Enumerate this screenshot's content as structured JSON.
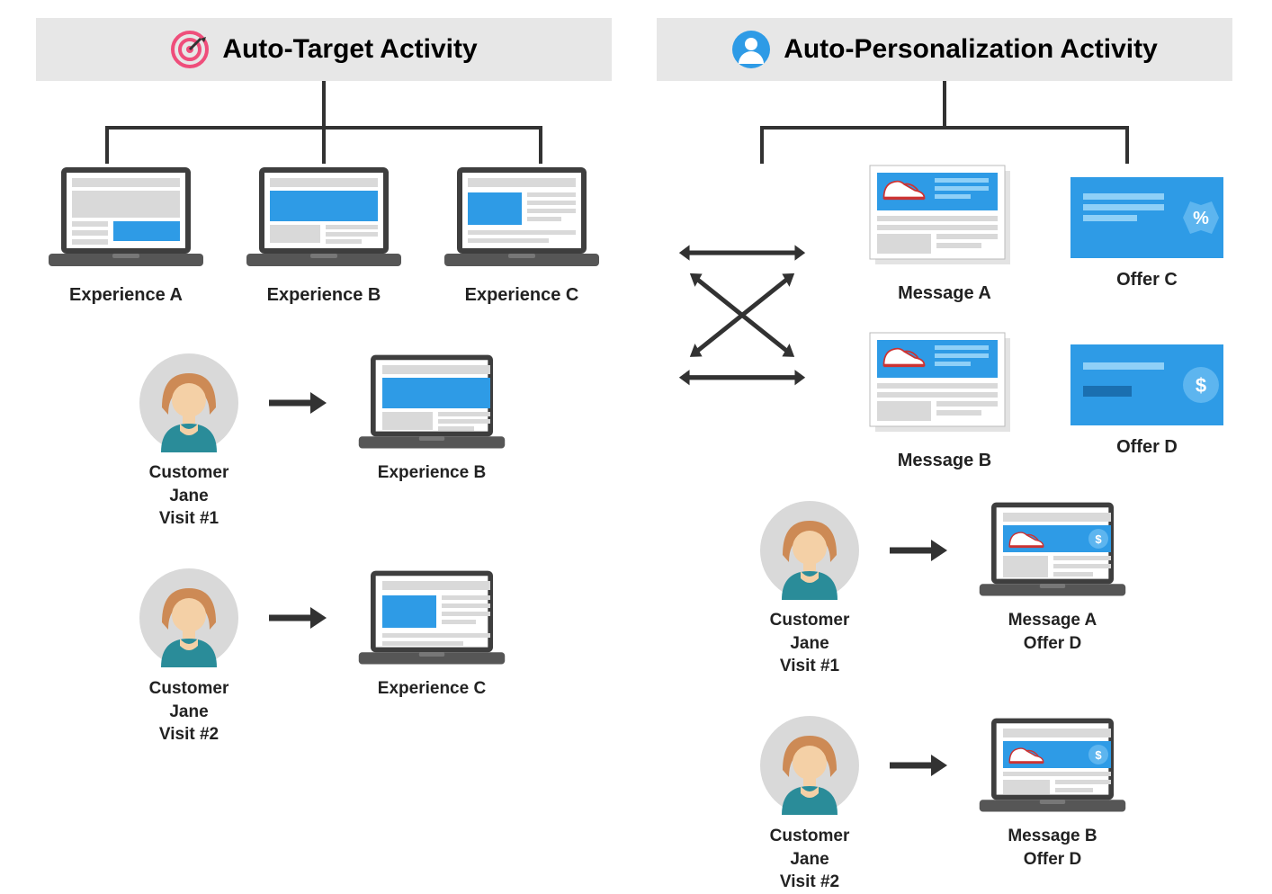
{
  "left": {
    "title": "Auto-Target Activity",
    "experiences": {
      "a": "Experience A",
      "b": "Experience B",
      "c": "Experience C"
    },
    "cust1": {
      "name": "Customer Jane",
      "visit": "Visit #1",
      "result": "Experience B"
    },
    "cust2": {
      "name": "Customer Jane",
      "visit": "Visit #2",
      "result": "Experience C"
    }
  },
  "right": {
    "title": "Auto-Personalization Activity",
    "messages": {
      "a": "Message A",
      "b": "Message B"
    },
    "offers": {
      "c": "Offer C",
      "d": "Offer D"
    },
    "cust1": {
      "name": "Customer Jane",
      "visit": "Visit #1",
      "result1": "Message A",
      "result2": "Offer D"
    },
    "cust2": {
      "name": "Customer Jane",
      "visit": "Visit #2",
      "result1": "Message B",
      "result2": "Offer D"
    }
  },
  "colors": {
    "accent": "#2e9be6",
    "accentLight": "#5db5ef",
    "gray": "#d9d9d9",
    "darkGray": "#4a4a4a",
    "pink": "#ef4e7b",
    "hair": "#cd8a55",
    "skin": "#f4d0a6",
    "teal": "#2a8c99"
  }
}
